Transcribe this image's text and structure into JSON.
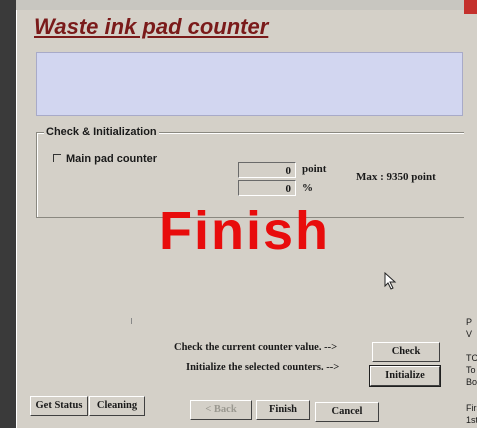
{
  "window": {
    "heading": "Waste ink pad counter"
  },
  "group": {
    "title": "Check & Initialization",
    "checkbox_label": "Main pad counter",
    "checkbox_checked": false,
    "point_value": "0",
    "point_unit": "point",
    "percent_value": "0",
    "percent_unit": "%",
    "max_text": "Max : 9350 point"
  },
  "overlay": {
    "text": "Finish",
    "color": "#e80c0c"
  },
  "instructions": {
    "check_text": "Check the current counter value. -->",
    "init_text": "Initialize the selected counters. -->"
  },
  "buttons": {
    "check": "Check",
    "initialize": "Initialize",
    "get_status": "Get Status",
    "cleaning": "Cleaning",
    "back": "< Back",
    "finish": "Finish",
    "cancel": "Cancel"
  },
  "right_edge_fragments": [
    "P",
    "V",
    "TC",
    "To",
    "Bo",
    "Firs",
    "1st"
  ],
  "colors": {
    "heading": "#7a1a1a",
    "panel": "#d2d6f0",
    "dialog": "#d4d0c8"
  }
}
